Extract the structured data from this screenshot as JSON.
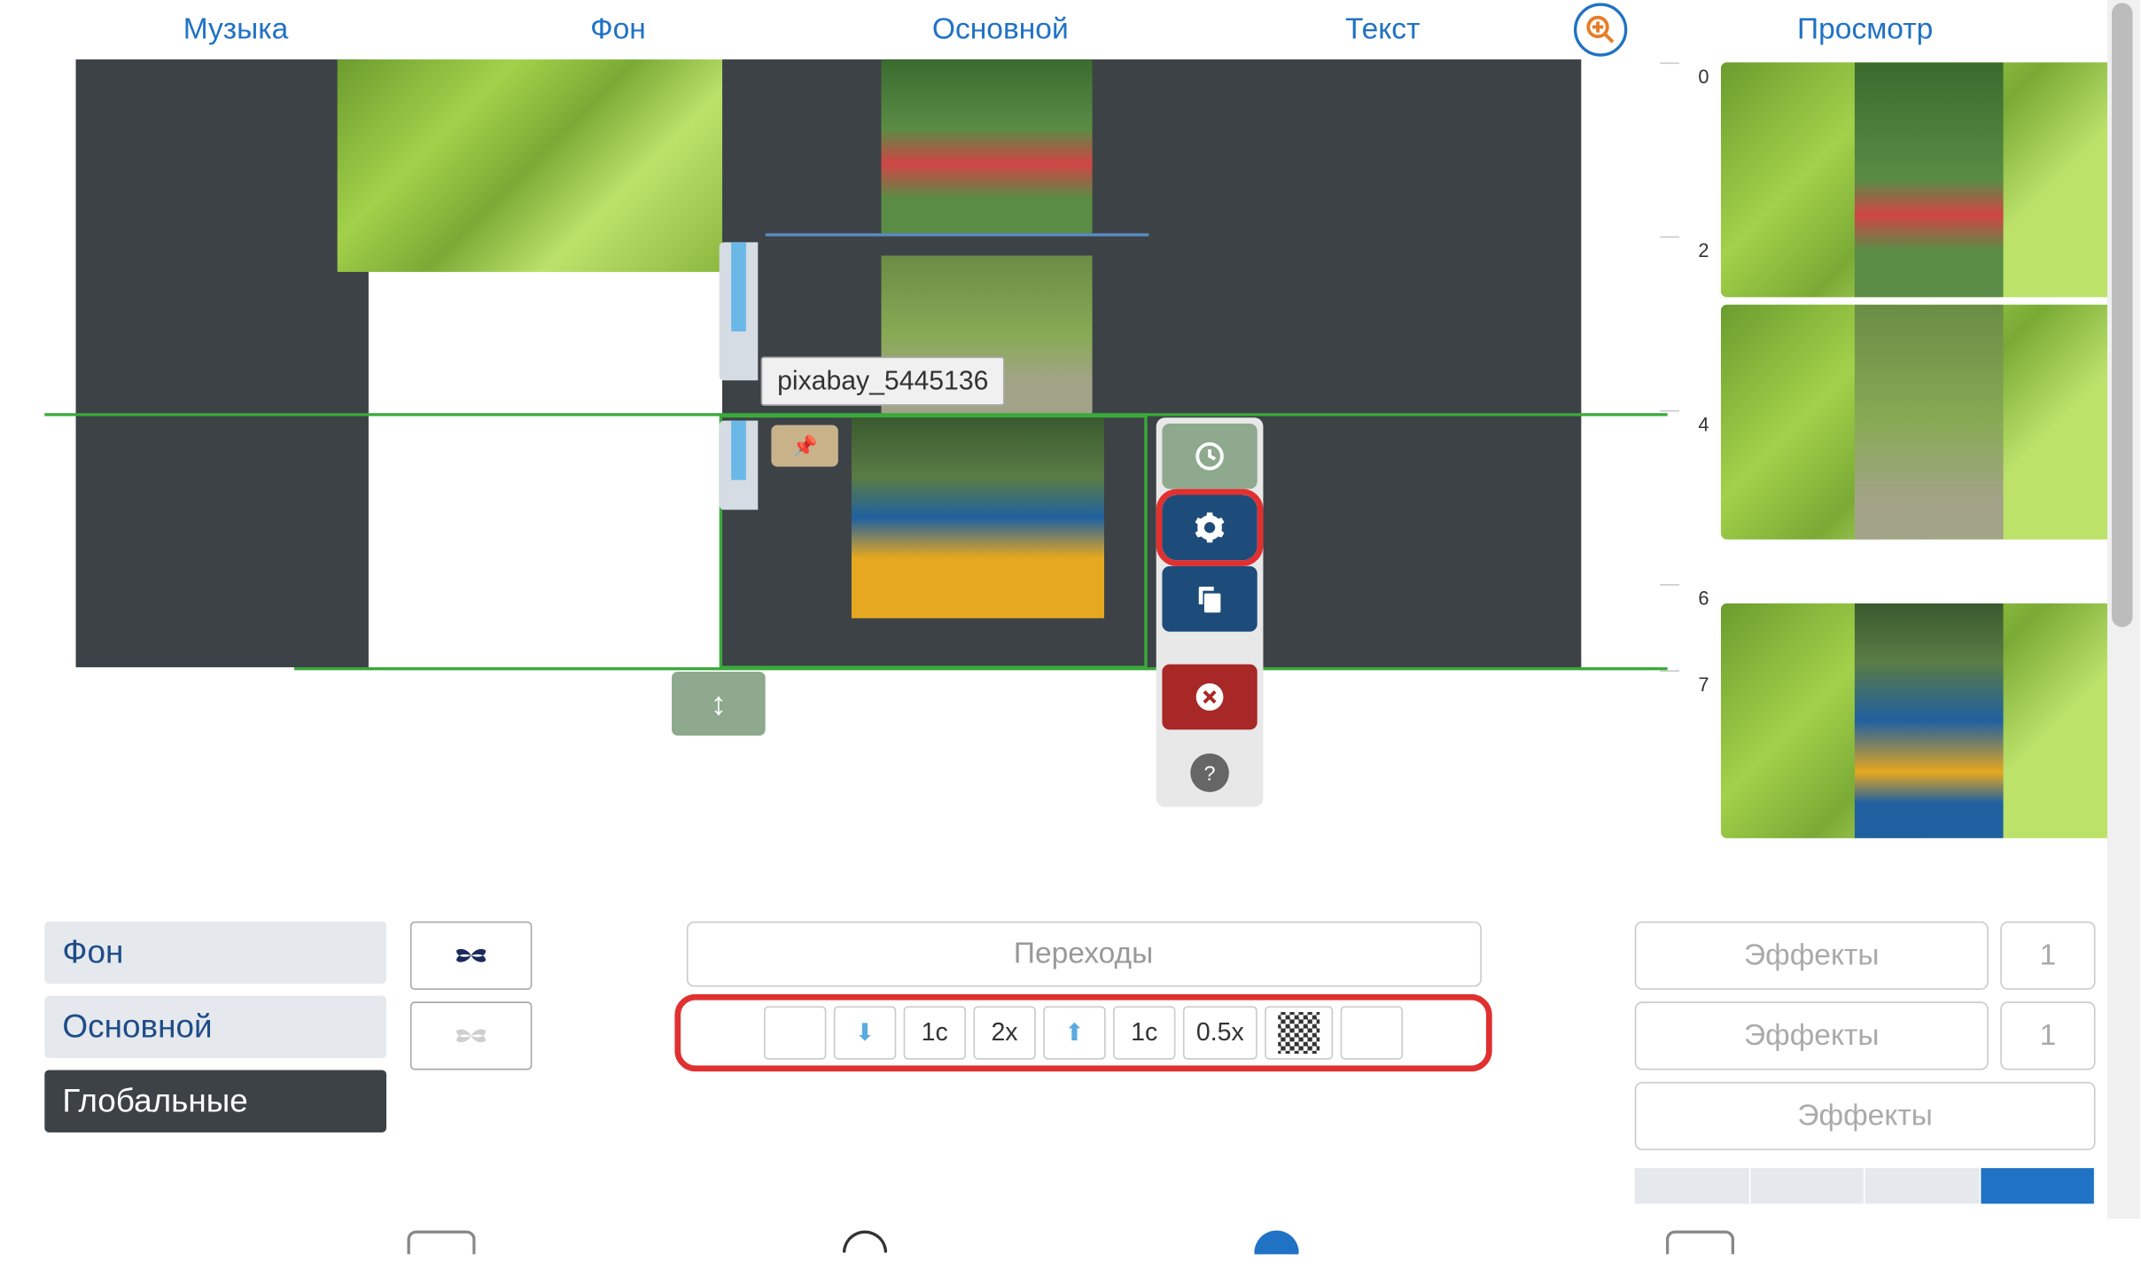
{
  "tabs": {
    "music": "Музыка",
    "background": "Фон",
    "main": "Основной",
    "text": "Текст",
    "preview": "Просмотр"
  },
  "tooltip": "pixabay_5445136",
  "ruler": {
    "t0": "0",
    "t2": "2",
    "t4": "4",
    "t6": "6",
    "t7": "7"
  },
  "layers": {
    "bg": "Фон",
    "main": "Основной",
    "global": "Глобальные"
  },
  "transitions_label": "Переходы",
  "transition_controls": {
    "btn1": "1c",
    "btn2": "2x",
    "btn3": "1c",
    "btn4": "0.5x"
  },
  "effects": {
    "label": "Эффекты",
    "count1": "1",
    "count2": "1"
  }
}
